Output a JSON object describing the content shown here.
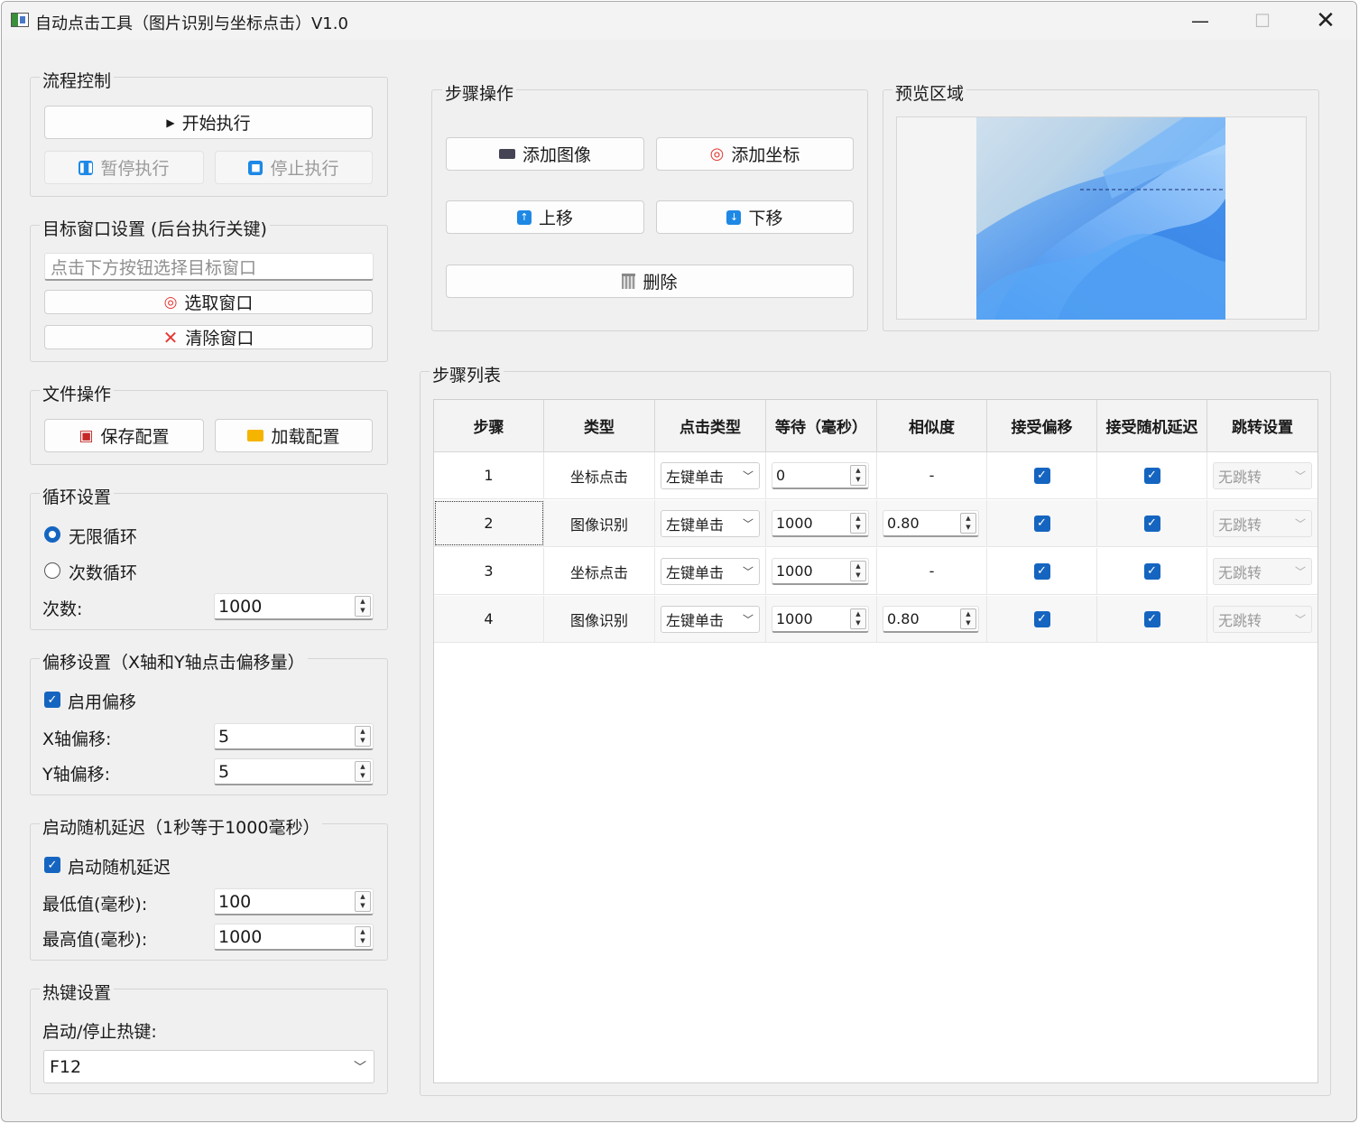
{
  "window": {
    "title": "自动点击工具（图片识别与坐标点击）V1.0",
    "minimize": "—",
    "maximize": "☐",
    "close": "✕"
  },
  "flow": {
    "title": "流程控制",
    "start": "开始执行",
    "pause": "暂停执行",
    "stop": "停止执行"
  },
  "target": {
    "title": "目标窗口设置 (后台执行关键)",
    "placeholder": "点击下方按钮选择目标窗口",
    "pick": "选取窗口",
    "clear": "清除窗口"
  },
  "file": {
    "title": "文件操作",
    "save": "保存配置",
    "load": "加载配置"
  },
  "loop": {
    "title": "循环设置",
    "infinite": "无限循环",
    "count_mode": "次数循环",
    "count_label": "次数:",
    "count_value": "1000",
    "selected": "infinite"
  },
  "offset": {
    "title": "偏移设置（X轴和Y轴点击偏移量）",
    "enable_label": "启用偏移",
    "enabled": true,
    "x_label": "X轴偏移:",
    "x_value": "5",
    "y_label": "Y轴偏移:",
    "y_value": "5"
  },
  "delay": {
    "title": "启动随机延迟（1秒等于1000毫秒）",
    "enable_label": "启动随机延迟",
    "enabled": true,
    "min_label": "最低值(毫秒):",
    "min_value": "100",
    "max_label": "最高值(毫秒):",
    "max_value": "1000"
  },
  "hotkey": {
    "title": "热键设置",
    "label": "启动/停止热键:",
    "value": "F12"
  },
  "steps_ops": {
    "title": "步骤操作",
    "add_image": "添加图像",
    "add_coord": "添加坐标",
    "move_up": "上移",
    "move_down": "下移",
    "delete": "删除"
  },
  "preview": {
    "title": "预览区域"
  },
  "steps_list": {
    "title": "步骤列表",
    "columns": [
      "步骤",
      "类型",
      "点击类型",
      "等待（毫秒）",
      "相似度",
      "接受偏移",
      "接受随机延迟",
      "跳转设置"
    ],
    "rows": [
      {
        "step": "1",
        "type": "坐标点击",
        "click": "左键单击",
        "wait": "0",
        "similarity": "-",
        "offset": true,
        "random": true,
        "jump": "无跳转"
      },
      {
        "step": "2",
        "type": "图像识别",
        "click": "左键单击",
        "wait": "1000",
        "similarity": "0.80",
        "offset": true,
        "random": true,
        "jump": "无跳转"
      },
      {
        "step": "3",
        "type": "坐标点击",
        "click": "左键单击",
        "wait": "1000",
        "similarity": "-",
        "offset": true,
        "random": true,
        "jump": "无跳转"
      },
      {
        "step": "4",
        "type": "图像识别",
        "click": "左键单击",
        "wait": "1000",
        "similarity": "0.80",
        "offset": true,
        "random": true,
        "jump": "无跳转"
      }
    ]
  },
  "colors": {
    "accent": "#1565c0",
    "icon_blue": "#1e88e5",
    "target_red": "#e53935",
    "folder_yellow": "#f5b400",
    "save_red": "#c62828"
  }
}
